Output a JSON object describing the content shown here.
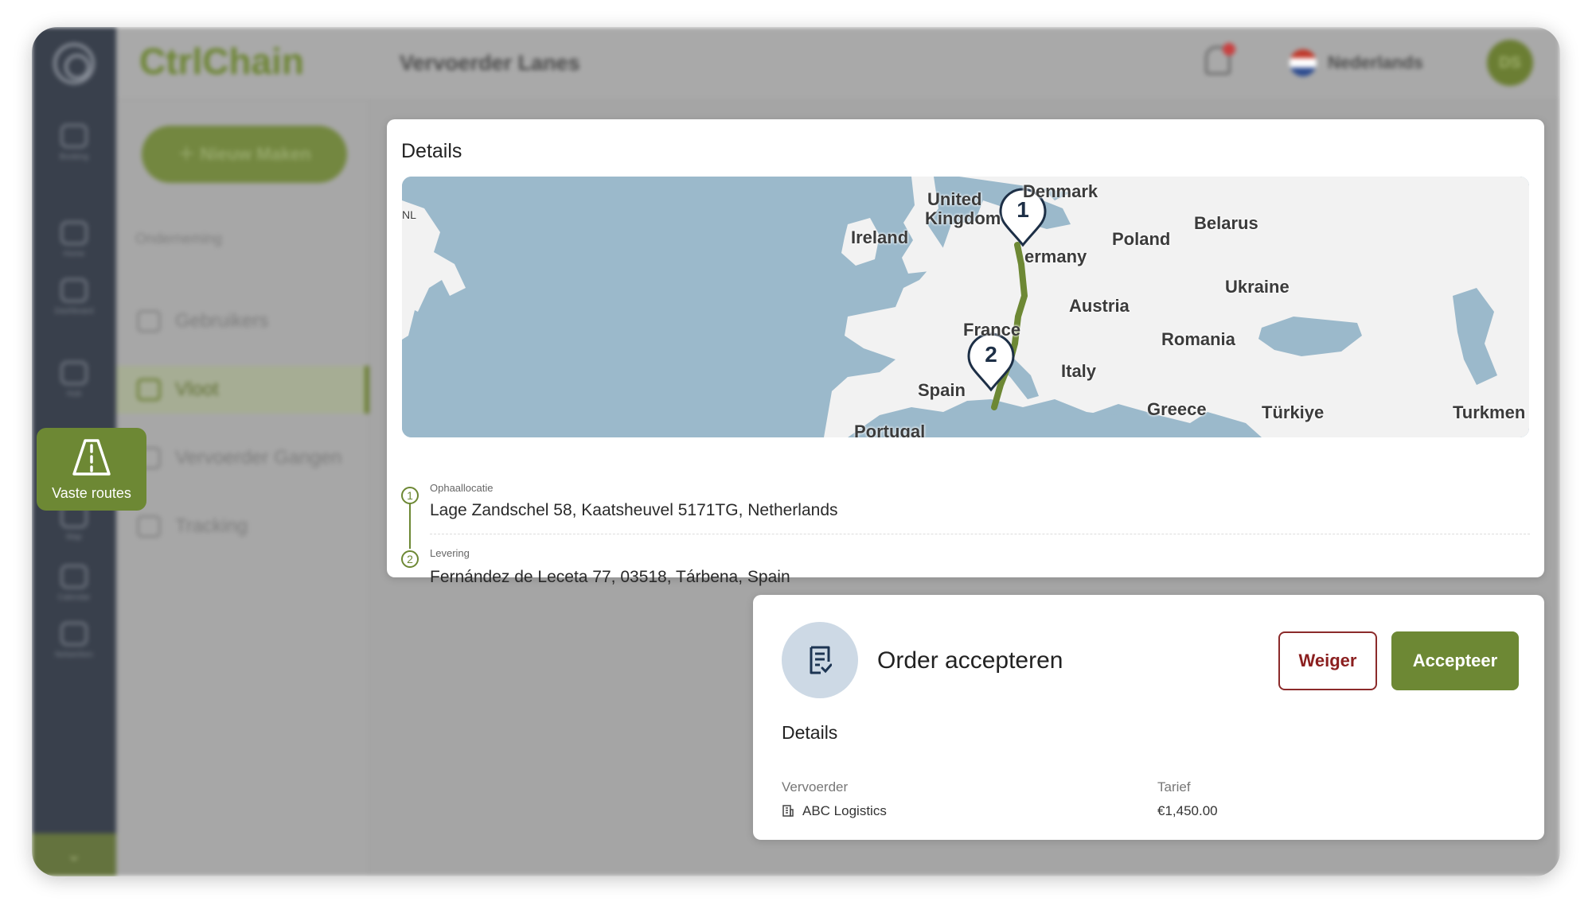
{
  "app": {
    "brand": "CtrlChain",
    "page_title": "Vervoerder Lanes",
    "language": "Nederlands",
    "avatar_initials": "DS",
    "new_button": "Nieuw Maken",
    "section_label": "Onderneming",
    "nav": [
      {
        "label": "Gebruikers",
        "icon": "users-icon"
      },
      {
        "label": "Vloot",
        "icon": "fleet-icon",
        "active": true
      },
      {
        "label": "Vervoerder Gangen",
        "icon": "lanes-icon"
      },
      {
        "label": "Tracking",
        "icon": "tracking-icon"
      }
    ],
    "rail": [
      {
        "label": "Booking",
        "icon": "booking-icon"
      },
      {
        "label": "Home",
        "icon": "home-icon"
      },
      {
        "label": "Dashboard",
        "icon": "globe-icon"
      },
      {
        "label": "Hub",
        "icon": "cloud-icon"
      },
      {
        "label": "Map",
        "icon": "document-icon"
      },
      {
        "label": "Calendar",
        "icon": "calendar-icon"
      },
      {
        "label": "Netwerken",
        "icon": "network-icon"
      }
    ],
    "highlight_chip": {
      "label": "Vaste routes",
      "icon": "road-icon"
    }
  },
  "details": {
    "title": "Details",
    "map_labels": {
      "nl": "NL",
      "united": "United",
      "kingdom": "Kingdom",
      "denmark": "Denmark",
      "ireland": "Ireland",
      "belarus": "Belarus",
      "poland": "Poland",
      "germany": "ermany",
      "ukraine": "Ukraine",
      "austria": "Austria",
      "france": "France",
      "romania": "Romania",
      "italy": "Italy",
      "spain": "Spain",
      "greece": "Greece",
      "turkiye": "Türkiye",
      "turkmen": "Turkmen",
      "portugal": "Portugal"
    },
    "pins": [
      "1",
      "2"
    ],
    "stops": [
      {
        "num": "1",
        "type": "Ophaallocatie",
        "address": "Lage Zandschel 58, Kaatsheuvel 5171TG, Netherlands"
      },
      {
        "num": "2",
        "type": "Levering",
        "address": "Fernández de Leceta 77, 03518, Tárbena, Spain"
      }
    ],
    "colors": {
      "route": "#6d8834",
      "water": "#9bb9cb",
      "land": "#f2f2f2"
    }
  },
  "order": {
    "title": "Order accepteren",
    "reject": "Weiger",
    "accept": "Accepteer",
    "subtitle": "Details",
    "carrier_label": "Vervoerder",
    "carrier_value": "ABC Logistics",
    "rate_label": "Tarief",
    "rate_value": "€1,450.00",
    "colors": {
      "accent": "#6d8834",
      "reject": "#8b1f1f"
    }
  }
}
